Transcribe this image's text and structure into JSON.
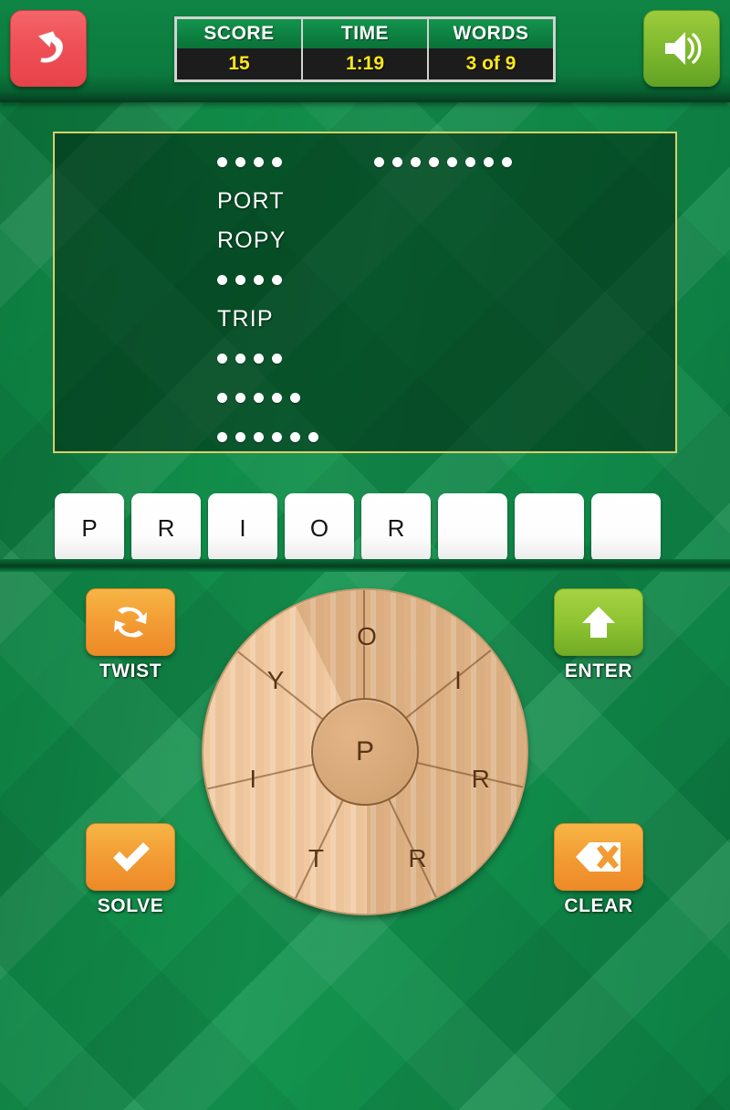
{
  "header": {
    "back_icon": "back-arrow-icon",
    "sound_icon": "speaker-on-icon",
    "stats": [
      {
        "label": "SCORE",
        "value": "15"
      },
      {
        "label": "TIME",
        "value": "1:19"
      },
      {
        "label": "WORDS",
        "value": "3 of 9"
      }
    ]
  },
  "word_panel": {
    "left_column": [
      {
        "solved": false,
        "length": 4,
        "text": ""
      },
      {
        "solved": true,
        "length": 4,
        "text": "PORT"
      },
      {
        "solved": true,
        "length": 4,
        "text": "ROPY"
      },
      {
        "solved": false,
        "length": 4,
        "text": ""
      },
      {
        "solved": true,
        "length": 4,
        "text": "TRIP"
      },
      {
        "solved": false,
        "length": 4,
        "text": ""
      },
      {
        "solved": false,
        "length": 5,
        "text": ""
      },
      {
        "solved": false,
        "length": 6,
        "text": ""
      }
    ],
    "right_column": [
      {
        "solved": false,
        "length": 8,
        "text": ""
      }
    ]
  },
  "tiles": [
    {
      "letter": "P",
      "filled": true
    },
    {
      "letter": "R",
      "filled": true
    },
    {
      "letter": "I",
      "filled": true
    },
    {
      "letter": "O",
      "filled": true
    },
    {
      "letter": "R",
      "filled": true
    },
    {
      "letter": "",
      "filled": false
    },
    {
      "letter": "",
      "filled": false
    },
    {
      "letter": "",
      "filled": false
    }
  ],
  "actions": {
    "twist": {
      "label": "TWIST",
      "icon": "refresh-cycle-icon",
      "color": "#f29a33"
    },
    "enter": {
      "label": "ENTER",
      "icon": "up-arrow-icon",
      "color": "#8cc231"
    },
    "solve": {
      "label": "SOLVE",
      "icon": "checkmark-icon",
      "color": "#f29a33"
    },
    "clear": {
      "label": "CLEAR",
      "icon": "backspace-icon",
      "color": "#f29a33"
    }
  },
  "wheel": {
    "center_letter": "P",
    "segments": [
      {
        "letter": "O",
        "used": true
      },
      {
        "letter": "I",
        "used": true
      },
      {
        "letter": "R",
        "used": true
      },
      {
        "letter": "R",
        "used": true
      },
      {
        "letter": "T",
        "used": false
      },
      {
        "letter": "I",
        "used": false
      },
      {
        "letter": "Y",
        "used": false
      }
    ]
  },
  "colors": {
    "background_green": "#0d8044",
    "panel_border": "#d9cf6a",
    "value_yellow": "#ffe81c",
    "back_red": "#ef4e55",
    "sound_green": "#7db72e",
    "wheel_light": "#f0c9a0",
    "wheel_dark": "#ddb184",
    "wheel_hub": "#d6a878",
    "letter_brown": "#5a3413"
  }
}
